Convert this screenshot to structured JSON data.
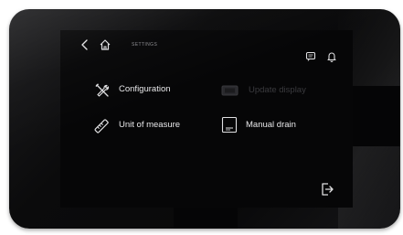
{
  "header": {
    "title": "SETTINGS",
    "back_icon": "chevron-left-icon",
    "home_icon": "home-icon",
    "chat_icon": "chat-bubble-icon",
    "bell_icon": "bell-icon"
  },
  "menu": {
    "configuration": {
      "label": "Configuration",
      "icon": "wrench-screwdriver-icon"
    },
    "update_display": {
      "label": "Update display",
      "icon": "display-update-icon",
      "enabled": false
    },
    "unit_of_measure": {
      "label": "Unit of measure",
      "icon": "ruler-icon"
    },
    "manual_drain": {
      "label": "Manual drain",
      "icon": "drain-icon"
    }
  },
  "footer": {
    "logout_icon": "logout-icon"
  },
  "colors": {
    "screen_bg": "#060607",
    "text": "#e8e8ea",
    "disabled_text": "#3a3a3e",
    "icon": "#e0e0e2"
  }
}
